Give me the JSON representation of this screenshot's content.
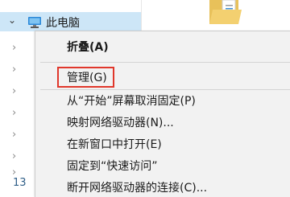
{
  "nav": {
    "this_pc_label": "此电脑",
    "item_count": "13"
  },
  "context_menu": {
    "items": [
      {
        "label": "折叠(A)",
        "bold": true
      },
      {
        "label": "管理(G)",
        "highlighted": true
      },
      {
        "label": "从“开始”屏幕取消固定(P)"
      },
      {
        "label": "映射网络驱动器(N)..."
      },
      {
        "label": "在新窗口中打开(E)"
      },
      {
        "label": "固定到“快速访问”"
      },
      {
        "label": "断开网络驱动器的连接(C)..."
      }
    ]
  },
  "colors": {
    "selection": "#cde6f7",
    "menu_background": "#f2f2f2",
    "highlight_border": "#e0372b",
    "count_text": "#2f5e87"
  },
  "icons": {
    "this_pc": "computer-icon",
    "expand_open": "chevron-down-icon",
    "expand_closed": "chevron-right-icon",
    "folder": "folder-icon"
  }
}
